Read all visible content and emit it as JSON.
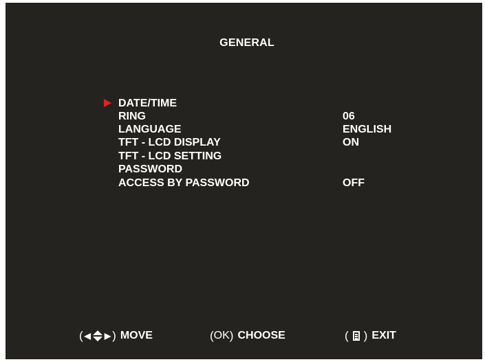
{
  "screen": {
    "title": "GENERAL"
  },
  "menu": {
    "selected_index": 0,
    "items": [
      {
        "label": "DATE/TIME",
        "value": ""
      },
      {
        "label": "RING",
        "value": "06"
      },
      {
        "label": "LANGUAGE",
        "value": "ENGLISH"
      },
      {
        "label": "TFT - LCD DISPLAY",
        "value": "ON"
      },
      {
        "label": "TFT - LCD SETTING",
        "value": ""
      },
      {
        "label": "PASSWORD",
        "value": ""
      },
      {
        "label": "ACCESS BY PASSWORD",
        "value": "OFF"
      }
    ]
  },
  "footer": {
    "move": {
      "open": "(",
      "close": ")",
      "label": "MOVE",
      "icons": [
        "left-arrow-icon",
        "up-down-arrow-icon",
        "right-arrow-icon"
      ]
    },
    "choose": {
      "open": "(",
      "key": "OK",
      "close": ")",
      "label": "CHOOSE"
    },
    "exit": {
      "open": "(",
      "close": ")",
      "label": "EXIT",
      "icons": [
        "menu-icon"
      ]
    }
  },
  "colors": {
    "background": "#252320",
    "text": "#ffffff",
    "cursor": "#e8201e"
  }
}
